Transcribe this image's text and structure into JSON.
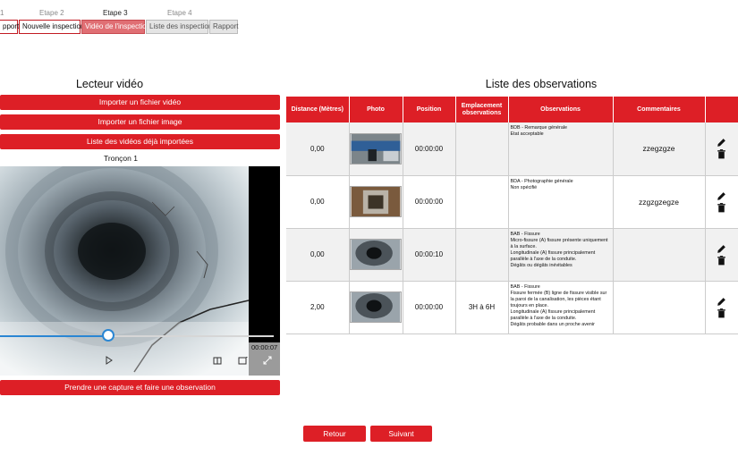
{
  "steps": {
    "step1": "1",
    "step2": "Etape 2",
    "step3": "Etape 3",
    "step4": "Etape 4"
  },
  "tabs": {
    "rapport_left": "pport",
    "nouvelle": "Nouvelle inspection",
    "videos": "Vidéo de l'inspection",
    "liste": "Liste des inspections",
    "rapport": "Rapport"
  },
  "player": {
    "title": "Lecteur vidéo",
    "import_video": "Importer un fichier vidéo",
    "import_image": "Importer un fichier image",
    "imported_list": "Liste des vidéos déjà importées",
    "troncon": "Tronçon 1",
    "time": "00:00:07",
    "progress": 0.395,
    "capture": "Prendre une capture et faire une observation"
  },
  "observations": {
    "title": "Liste des observations",
    "headers": {
      "distance": "Distance (Mètres)",
      "photo": "Photo",
      "position": "Position",
      "emplacement": "Emplacement observations",
      "observations": "Observations",
      "commentaires": "Commentaires"
    },
    "rows": [
      {
        "distance": "0,00",
        "photo": "pipe-blue-photo",
        "position": "00:00:00",
        "emplacement": "",
        "obs_lines": [
          "BDB - Remarque générale",
          "Etat acceptable"
        ],
        "comment": "zzegzgze"
      },
      {
        "distance": "0,00",
        "photo": "manhole-photo",
        "position": "00:00:00",
        "emplacement": "",
        "obs_lines": [
          "BDA - Photographie générale",
          "Non spécifié"
        ],
        "comment": "zzgzgzegze"
      },
      {
        "distance": "0,00",
        "photo": "pipe-interior-photo",
        "position": "00:00:10",
        "emplacement": "",
        "obs_lines": [
          "BAB - Fissure",
          "Micro-fissure (A) fissure présente uniquement à la surface.",
          "Longitudinale (A) fissure principalement parallèle à l'axe de la conduite.",
          "Dégâts ou dégâts inévitables"
        ],
        "comment": ""
      },
      {
        "distance": "2,00",
        "photo": "pipe-interior-photo",
        "position": "00:00:00",
        "emplacement": "3H à 6H",
        "obs_lines": [
          "BAB - Fissure",
          "Fissure fermée (B) ligne de fissure visible sur la paroi de la canalisation, les pièces étant toujours en place.",
          "Longitudinale (A) fissure principalement parallèle à l'axe de la conduite.",
          "Dégâts probable dans un proche avenir"
        ],
        "comment": ""
      }
    ]
  },
  "nav": {
    "retour": "Retour",
    "suivant": "Suivant"
  },
  "colors": {
    "accent": "#dd1f26",
    "active_tab": "#e06f74",
    "seek": "#2a86d3"
  }
}
